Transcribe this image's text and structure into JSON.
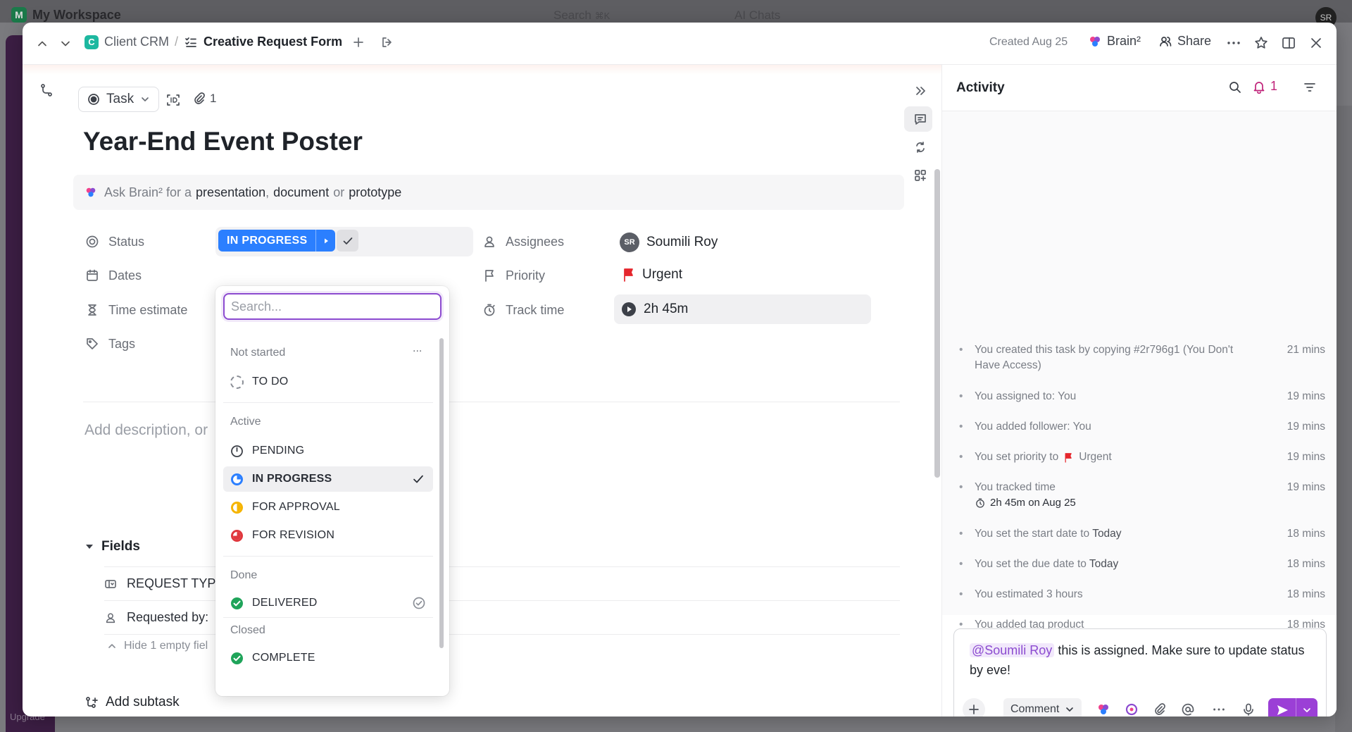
{
  "background": {
    "workspace": "My Workspace",
    "workspace_initial": "M",
    "search": "Search",
    "search_shortcut": "⌘K",
    "ai_chats": "AI Chats",
    "user_initials": "SR",
    "upgrade": "Upgrade"
  },
  "breadcrumb": {
    "space_initial": "C",
    "space": "Client CRM",
    "separator": "/",
    "list": "Creative Request Form"
  },
  "topbar": {
    "created": "Created Aug 25",
    "brain": "Brain²",
    "share": "Share"
  },
  "task": {
    "type": "Task",
    "attachments": "1",
    "title": "Year-End Event Poster"
  },
  "brain_prompt": {
    "prefix": "Ask Brain² for a",
    "opt1": "presentation",
    "sep1": ",",
    "opt2": "document",
    "sep2": "or",
    "opt3": "prototype"
  },
  "fields": {
    "status_label": "Status",
    "status_value": "IN PROGRESS",
    "dates_label": "Dates",
    "time_estimate_label": "Time estimate",
    "tags_label": "Tags",
    "assignees_label": "Assignees",
    "assignee_initials": "SR",
    "assignee_name": "Soumili Roy",
    "priority_label": "Priority",
    "priority_value": "Urgent",
    "track_time_label": "Track time",
    "track_time_value": "2h 45m"
  },
  "description_placeholder": "Add description, or",
  "custom_fields": {
    "heading": "Fields",
    "request_type": "REQUEST TYP",
    "requested_by": "Requested by:",
    "hide_empty": "Hide 1 empty fiel"
  },
  "add_subtask": "Add subtask",
  "status_dropdown": {
    "search_placeholder": "Search...",
    "more": "...",
    "groups": {
      "not_started": "Not started",
      "active": "Active",
      "done": "Done",
      "closed": "Closed"
    },
    "items": {
      "todo": "TO DO",
      "pending": "PENDING",
      "in_progress": "IN PROGRESS",
      "for_approval": "FOR APPROVAL",
      "for_revision": "FOR REVISION",
      "delivered": "DELIVERED",
      "complete": "COMPLETE"
    },
    "selected": "IN PROGRESS"
  },
  "activity": {
    "title": "Activity",
    "notification_count": "1",
    "entries": [
      {
        "text": "You created this task by copying #2r796g1 (You Don't Have Access)",
        "time": "21 mins"
      },
      {
        "text": "You assigned to: You",
        "time": "19 mins"
      },
      {
        "text": "You added follower: You",
        "time": "19 mins"
      },
      {
        "text": "You set priority to",
        "highlight": "Urgent",
        "time": "19 mins"
      },
      {
        "text": "You tracked time",
        "detail": "2h 45m on Aug 25",
        "time": "19 mins"
      },
      {
        "text": "You set the start date to",
        "highlight": "Today",
        "time": "18 mins"
      },
      {
        "text": "You set the due date to",
        "highlight": "Today",
        "time": "18 mins"
      },
      {
        "text": "You estimated 3 hours",
        "time": "18 mins"
      },
      {
        "text": "You added tag product",
        "time": "18 mins"
      }
    ]
  },
  "comment": {
    "mention": "@Soumili Roy",
    "text": "this is assigned. Make sure to update status by eve!",
    "type": "Comment"
  },
  "colors": {
    "accent_purple": "#9b3fd6",
    "status_blue": "#2b7fff",
    "urgent_red": "#e5262d",
    "approval_yellow": "#f5b400",
    "revision_red": "#e0383e",
    "done_green": "#1fa45a"
  }
}
